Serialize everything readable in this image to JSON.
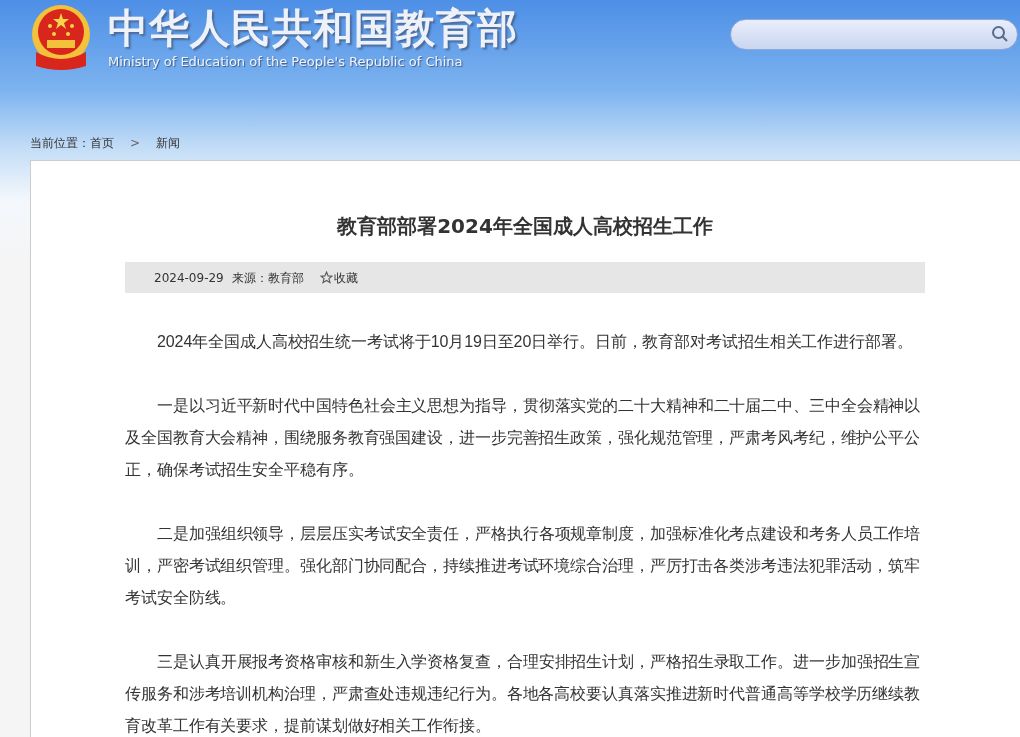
{
  "header": {
    "title_cn": "中华人民共和国教育部",
    "title_en": "Ministry of Education of the People's Republic of China"
  },
  "breadcrumb": [
    {
      "kind": "text",
      "label": "当前位置："
    },
    {
      "kind": "link",
      "label": "首页"
    },
    {
      "kind": "separator",
      "label": ">"
    },
    {
      "kind": "link",
      "label": "新闻"
    }
  ],
  "article": {
    "title": "教育部部署2024年全国成人高校招生工作",
    "meta": {
      "date": "2024-09-29",
      "source": "来源：教育部",
      "favorite": "收藏"
    },
    "paragraphs": [
      "2024年全国成人高校招生统一考试将于10月19日至20日举行。日前，教育部对考试招生相关工作进行部署。",
      "一是以习近平新时代中国特色社会主义思想为指导，贯彻落实党的二十大精神和二十届二中、三中全会精神以及全国教育大会精神，围绕服务教育强国建设，进一步完善招生政策，强化规范管理，严肃考风考纪，维护公平公正，确保考试招生安全平稳有序。",
      "二是加强组织领导，层层压实考试安全责任，严格执行各项规章制度，加强标准化考点建设和考务人员工作培训，严密考试组织管理。强化部门协同配合，持续推进考试环境综合治理，严厉打击各类涉考违法犯罪活动，筑牢考试安全防线。",
      "三是认真开展报考资格审核和新生入学资格复查，合理安排招生计划，严格招生录取工作。进一步加强招生宣传服务和涉考培训机构治理，严肃查处违规违纪行为。各地各高校要认真落实推进新时代普通高等学校学历继续教育改革工作有关要求，提前谋划做好相关工作衔接。"
    ]
  }
}
